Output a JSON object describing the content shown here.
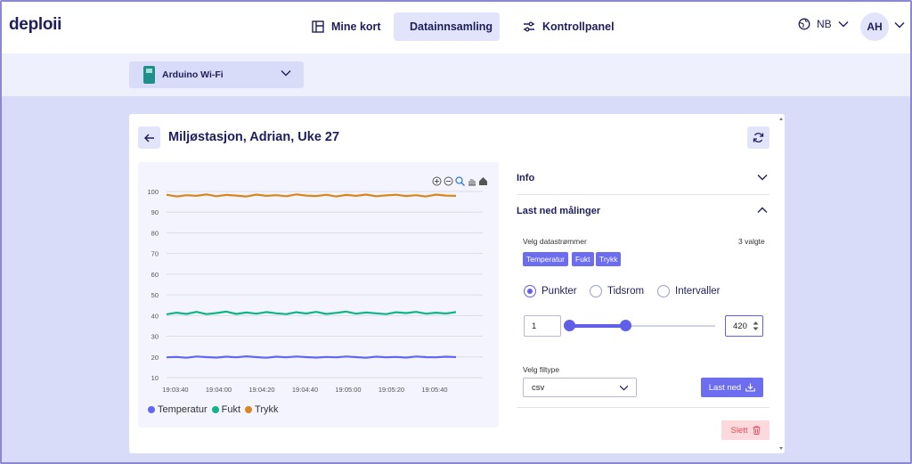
{
  "app": {
    "logo": "deploii"
  },
  "nav": {
    "items": [
      {
        "label": "Mine kort",
        "icon": "dashboard-icon"
      },
      {
        "label": "Datainnsamling",
        "icon": "save-icon",
        "active": true
      },
      {
        "label": "Kontrollpanel",
        "icon": "sliders-icon"
      }
    ],
    "language": "NB",
    "user_initials": "AH"
  },
  "device": {
    "selected": "Arduino Wi-Fi"
  },
  "card": {
    "title": "Miljøstasjon, Adrian, Uke 27"
  },
  "chart_data": {
    "type": "line",
    "x": [
      "19:03:40",
      "19:04:00",
      "19:04:20",
      "19:04:40",
      "19:05:00",
      "19:05:20",
      "19:05:40"
    ],
    "yticks": [
      10,
      20,
      30,
      40,
      50,
      60,
      70,
      80,
      90,
      100
    ],
    "ylim": [
      10,
      100
    ],
    "grid": true,
    "legend_position": "bottom-left",
    "series": [
      {
        "name": "Temperatur",
        "color": "#6366f1",
        "approx_value": 20,
        "values": [
          19.8,
          20.0,
          19.6,
          20.2,
          19.9,
          19.7,
          20.1,
          19.8,
          20.3,
          19.9,
          19.6,
          20.1,
          19.8,
          20.2,
          19.9,
          19.7,
          20.0,
          19.8,
          20.2,
          19.9,
          19.6,
          20.1,
          19.8,
          20.0,
          19.7,
          20.2,
          19.9,
          19.8,
          20.1,
          19.9
        ]
      },
      {
        "name": "Fukt",
        "color": "#10b48a",
        "approx_value": 41,
        "values": [
          40.6,
          41.4,
          40.8,
          41.8,
          40.7,
          41.2,
          41.9,
          40.8,
          41.5,
          40.9,
          41.7,
          41.1,
          40.7,
          41.6,
          41.0,
          41.8,
          40.8,
          41.3,
          41.9,
          40.9,
          41.5,
          41.1,
          40.7,
          41.6,
          41.2,
          41.8,
          40.9,
          41.4,
          41.0,
          41.7
        ]
      },
      {
        "name": "Trykk",
        "color": "#d9861c",
        "approx_value": 98,
        "values": [
          98.4,
          97.6,
          98.2,
          97.9,
          98.6,
          97.7,
          98.3,
          98.0,
          97.6,
          98.5,
          97.9,
          98.2,
          97.7,
          98.6,
          98.0,
          97.8,
          98.4,
          97.6,
          98.3,
          97.9,
          98.5,
          97.7,
          98.1,
          98.4,
          97.8,
          98.2,
          97.6,
          98.5,
          98.0,
          97.9
        ]
      }
    ]
  },
  "accordion": {
    "info": "Info",
    "download": "Last ned målinger"
  },
  "download": {
    "streams_label": "Velg datastrømmer",
    "streams_count": "3 valgte",
    "streams": [
      "Temperatur",
      "Fukt",
      "Trykk"
    ],
    "modes": [
      "Punkter",
      "Tidsrom",
      "Intervaller"
    ],
    "selected_mode": "Punkter",
    "range_min": "1",
    "range_max": "420",
    "filetype_label": "Velg filtype",
    "filetype": "csv",
    "download_button": "Last ned",
    "delete_button": "Slett"
  }
}
